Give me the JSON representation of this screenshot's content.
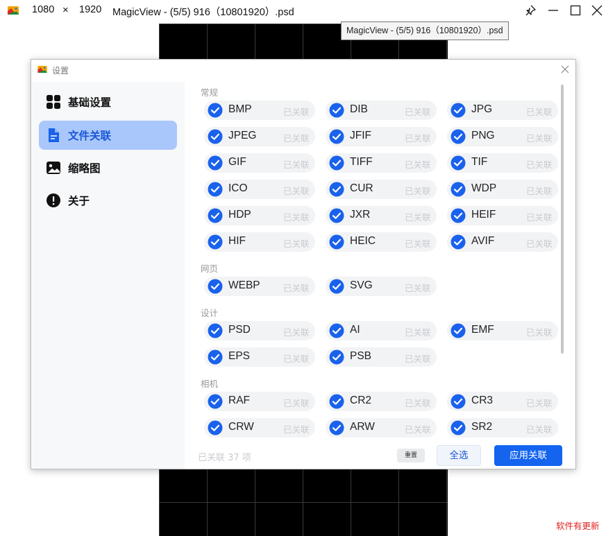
{
  "window": {
    "width_value": "1080",
    "times": "×",
    "height_value": "1920",
    "title": "MagicView - (5/5) 916（10801920）.psd",
    "tooltip": "MagicView - (5/5) 916（10801920）.psd"
  },
  "update_notice": "软件有更新",
  "dialog": {
    "title": "设置",
    "sidebar": [
      {
        "label": "基础设置",
        "icon": "grid-icon",
        "active": false
      },
      {
        "label": "文件关联",
        "icon": "file-icon",
        "active": true
      },
      {
        "label": "缩略图",
        "icon": "image-icon",
        "active": false
      },
      {
        "label": "关于",
        "icon": "info-icon",
        "active": false
      }
    ],
    "sections": [
      {
        "title": "常规",
        "items": [
          {
            "ext": "BMP",
            "state": "已关联"
          },
          {
            "ext": "DIB",
            "state": "已关联"
          },
          {
            "ext": "JPG",
            "state": "已关联"
          },
          {
            "ext": "JPEG",
            "state": "已关联"
          },
          {
            "ext": "JFIF",
            "state": "已关联"
          },
          {
            "ext": "PNG",
            "state": "已关联"
          },
          {
            "ext": "GIF",
            "state": "已关联"
          },
          {
            "ext": "TIFF",
            "state": "已关联"
          },
          {
            "ext": "TIF",
            "state": "已关联"
          },
          {
            "ext": "ICO",
            "state": "已关联"
          },
          {
            "ext": "CUR",
            "state": "已关联"
          },
          {
            "ext": "WDP",
            "state": "已关联"
          },
          {
            "ext": "HDP",
            "state": "已关联"
          },
          {
            "ext": "JXR",
            "state": "已关联"
          },
          {
            "ext": "HEIF",
            "state": "已关联"
          },
          {
            "ext": "HIF",
            "state": "已关联"
          },
          {
            "ext": "HEIC",
            "state": "已关联"
          },
          {
            "ext": "AVIF",
            "state": "已关联"
          }
        ]
      },
      {
        "title": "网页",
        "items": [
          {
            "ext": "WEBP",
            "state": "已关联"
          },
          {
            "ext": "SVG",
            "state": "已关联"
          }
        ]
      },
      {
        "title": "设计",
        "items": [
          {
            "ext": "PSD",
            "state": "已关联"
          },
          {
            "ext": "AI",
            "state": "已关联"
          },
          {
            "ext": "EMF",
            "state": "已关联"
          },
          {
            "ext": "EPS",
            "state": "已关联"
          },
          {
            "ext": "PSB",
            "state": "已关联"
          }
        ]
      },
      {
        "title": "相机",
        "items": [
          {
            "ext": "RAF",
            "state": "已关联"
          },
          {
            "ext": "CR2",
            "state": "已关联"
          },
          {
            "ext": "CR3",
            "state": "已关联"
          },
          {
            "ext": "CRW",
            "state": "已关联"
          },
          {
            "ext": "ARW",
            "state": "已关联"
          },
          {
            "ext": "SR2",
            "state": "已关联"
          }
        ]
      }
    ],
    "footer": {
      "count_text": "已关联 37 项",
      "reset_label": "重置",
      "select_all_label": "全选",
      "apply_label": "应用关联"
    }
  },
  "colors": {
    "accent": "#1464ef",
    "active_nav": "#a9c7fb",
    "check": "#1a62ec"
  }
}
